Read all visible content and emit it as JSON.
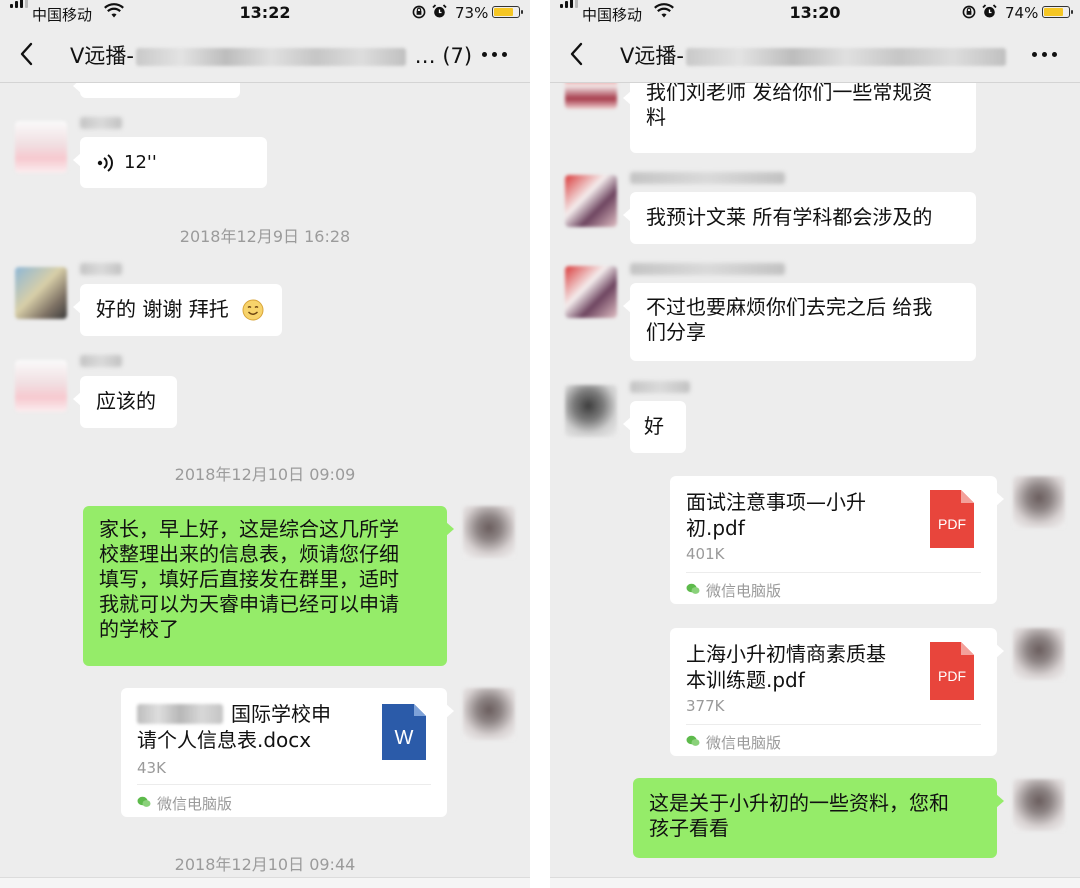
{
  "left_phone": {
    "status": {
      "carrier": "中国移动",
      "time": "13:22",
      "battery": "73%",
      "battery_level": 0.73
    },
    "nav": {
      "title_prefix": "V远播-",
      "title_suffix": "(7)"
    },
    "voice_duration": "12''",
    "timestamps": [
      "2018年12月9日 16:28",
      "2018年12月10日 09:09",
      "2018年12月10日 09:44"
    ],
    "messages": {
      "m1": "好的 谢谢 拜托",
      "m2": "应该的",
      "m3": [
        "家长，早上好，这是综合这几所学",
        "校整理出来的信息表，烦请您仔细",
        "填写，填好后直接发在群里，适时",
        "我就可以为天睿申请已经可以申请",
        "的学校了"
      ]
    },
    "file": {
      "name_line1": "国际学校申",
      "name_line2": "请个人信息表.docx",
      "size": "43K",
      "source": "微信电脑版",
      "icon_letter": "W"
    }
  },
  "right_phone": {
    "status": {
      "carrier": "中国移动",
      "time": "13:20",
      "battery": "74%",
      "battery_level": 0.74
    },
    "nav": {
      "title_prefix": "V远播-"
    },
    "messages": {
      "m1": [
        "我们刘老师 发给你们一些常规资",
        "料"
      ],
      "m2": "我预计文莱 所有学科都会涉及的",
      "m3": [
        "不过也要麻烦你们去完之后 给我",
        "们分享"
      ],
      "m4": "好",
      "m5": [
        "这是关于小升初的一些资料，您和",
        "孩子看看"
      ]
    },
    "files": [
      {
        "name_line1": "面试注意事项—小升",
        "name_line2": "初.pdf",
        "size": "401K",
        "source": "微信电脑版",
        "icon_label": "PDF"
      },
      {
        "name_line1": "上海小升初情商素质基",
        "name_line2": "本训练题.pdf",
        "size": "377K",
        "source": "微信电脑版",
        "icon_label": "PDF"
      }
    ]
  },
  "colors": {
    "bg": "#ededed",
    "self_bubble": "#95ec69",
    "other_bubble": "#ffffff",
    "pdf": "#e8453c",
    "word": "#2b5ba9",
    "battery": "#f5c623"
  },
  "icons": [
    "signal-icon",
    "wifi-icon",
    "rotation-lock-icon",
    "alarm-icon",
    "battery-icon",
    "back-icon",
    "more-icon",
    "voice-wave-icon",
    "smile-emoji-icon",
    "word-file-icon",
    "pdf-file-icon",
    "wechat-pc-icon"
  ]
}
